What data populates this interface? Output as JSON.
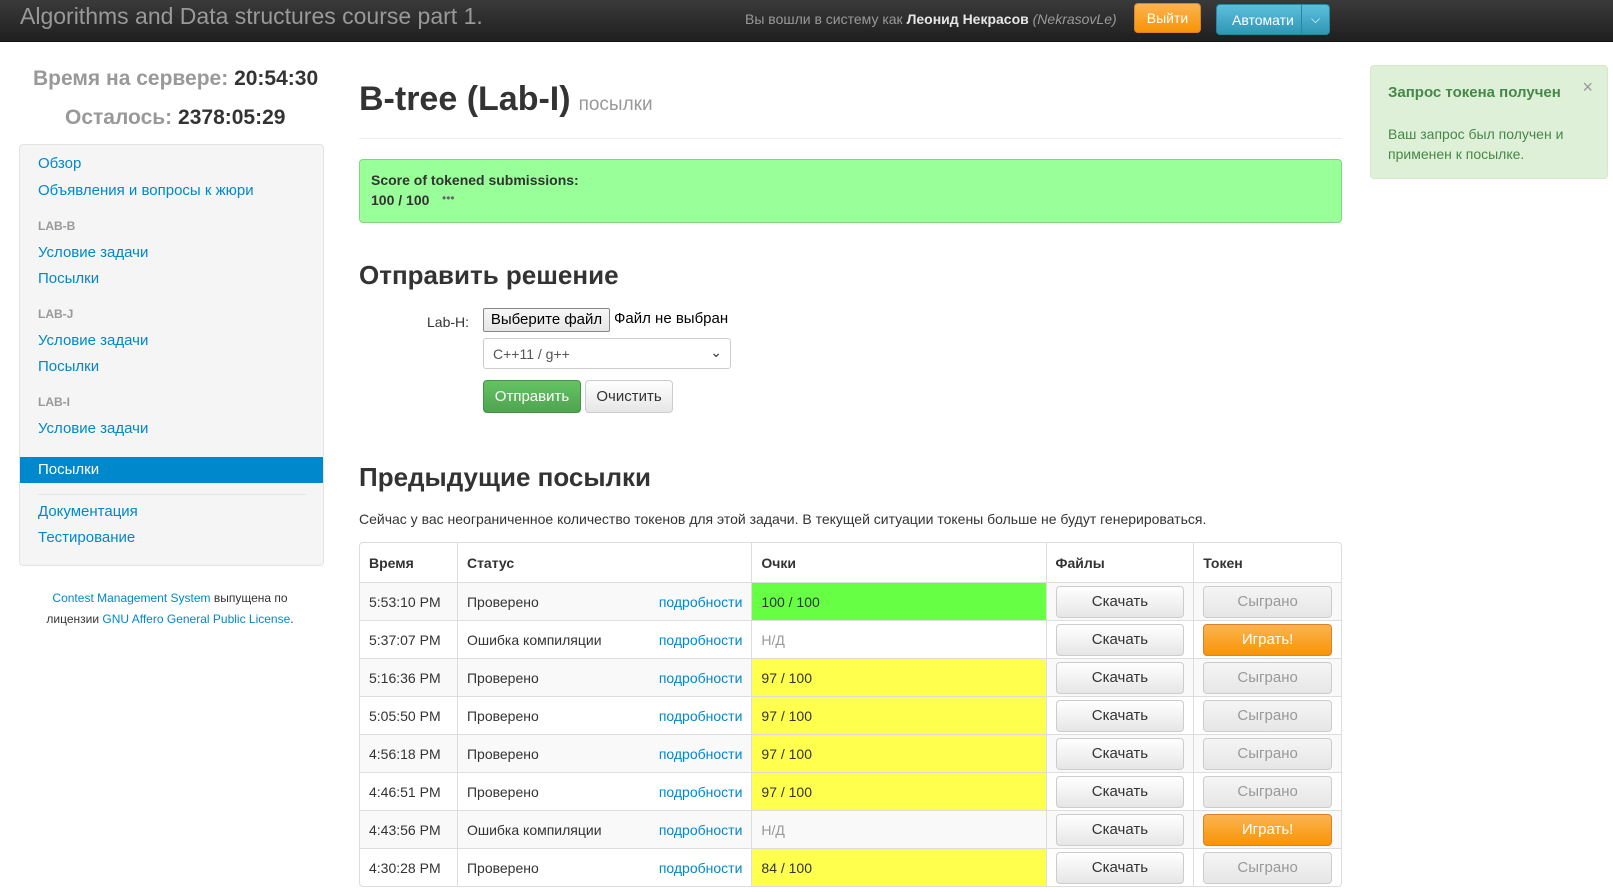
{
  "navbar": {
    "brand": "Algorithms and Data structures course part 1.",
    "login_prefix": "Вы вошли в систему как ",
    "user_name": "Леонид Некрасов",
    "user_login": "(NekrasovLe)",
    "logout_label": "Выйти",
    "auto_label": "Автомати"
  },
  "sidebar": {
    "server_time_label": "Время на сервере:",
    "server_time": "20:54:30",
    "remaining_label": "Осталось:",
    "remaining": "2378:05:29",
    "links": {
      "overview": "Обзор",
      "announcements": "Объявления и вопросы к жюри",
      "lab_b_header": "LAB-B",
      "lab_b_statement": "Условие задачи",
      "lab_b_submissions": "Посылки",
      "lab_j_header": "LAB-J",
      "lab_j_statement": "Условие задачи",
      "lab_j_submissions": "Посылки",
      "lab_i_header": "LAB-I",
      "lab_i_statement": "Условие задачи",
      "lab_i_submissions": "Посылки",
      "docs": "Документация",
      "testing": "Тестирование"
    },
    "footer": {
      "cms": "Contest Management System",
      "middle": " выпущена по лицензии ",
      "license": "GNU Affero General Public License",
      "end": "."
    }
  },
  "main": {
    "title": "B-tree (Lab-I)",
    "subtitle": "посылки",
    "score_label": "Score of tokened submissions:",
    "score_value": "100 / 100",
    "submit_title": "Отправить решение",
    "file_field_label": "Lab-H:",
    "file_button": "Выберите файл",
    "file_none": "Файл не выбран",
    "language": "C++11 / g++",
    "send_label": "Отправить",
    "clear_label": "Очистить",
    "prev_title": "Предыдущие посылки",
    "token_info": "Сейчас у вас неограниченное количество токенов для этой задачи. В текущей ситуации токены больше не будут генерироваться."
  },
  "table": {
    "headers": [
      "Время",
      "Статус",
      "Очки",
      "Файлы",
      "Токен"
    ],
    "details_label": "подробности",
    "download_label": "Скачать",
    "rows": [
      {
        "time": "5:53:10 PM",
        "status": "Проверено",
        "score": "100 / 100",
        "score_kind": "full",
        "token": "Сыграно",
        "token_kind": "played"
      },
      {
        "time": "5:37:07 PM",
        "status": "Ошибка компиляции",
        "score": "Н/Д",
        "score_kind": "na",
        "token": "Играть!",
        "token_kind": "play"
      },
      {
        "time": "5:16:36 PM",
        "status": "Проверено",
        "score": "97 / 100",
        "score_kind": "partial",
        "token": "Сыграно",
        "token_kind": "played"
      },
      {
        "time": "5:05:50 PM",
        "status": "Проверено",
        "score": "97 / 100",
        "score_kind": "partial",
        "token": "Сыграно",
        "token_kind": "played"
      },
      {
        "time": "4:56:18 PM",
        "status": "Проверено",
        "score": "97 / 100",
        "score_kind": "partial",
        "token": "Сыграно",
        "token_kind": "played"
      },
      {
        "time": "4:46:51 PM",
        "status": "Проверено",
        "score": "97 / 100",
        "score_kind": "partial",
        "token": "Сыграно",
        "token_kind": "played"
      },
      {
        "time": "4:43:56 PM",
        "status": "Ошибка компиляции",
        "score": "Н/Д",
        "score_kind": "na",
        "token": "Играть!",
        "token_kind": "play"
      },
      {
        "time": "4:30:28 PM",
        "status": "Проверено",
        "score": "84 / 100",
        "score_kind": "partial",
        "token": "Сыграно",
        "token_kind": "played"
      }
    ]
  },
  "notification": {
    "title": "Запрос токена получен",
    "body": "Ваш запрос был получен и применен к посылке.",
    "close_icon": "×"
  },
  "colors": {
    "navbar_bg": "#222222",
    "link": "#0088cc",
    "score_full": "#66ff44",
    "score_partial": "#ffff4d",
    "score_box": "#99ff99",
    "play_button": "#f89406",
    "send_button": "#51a351"
  }
}
